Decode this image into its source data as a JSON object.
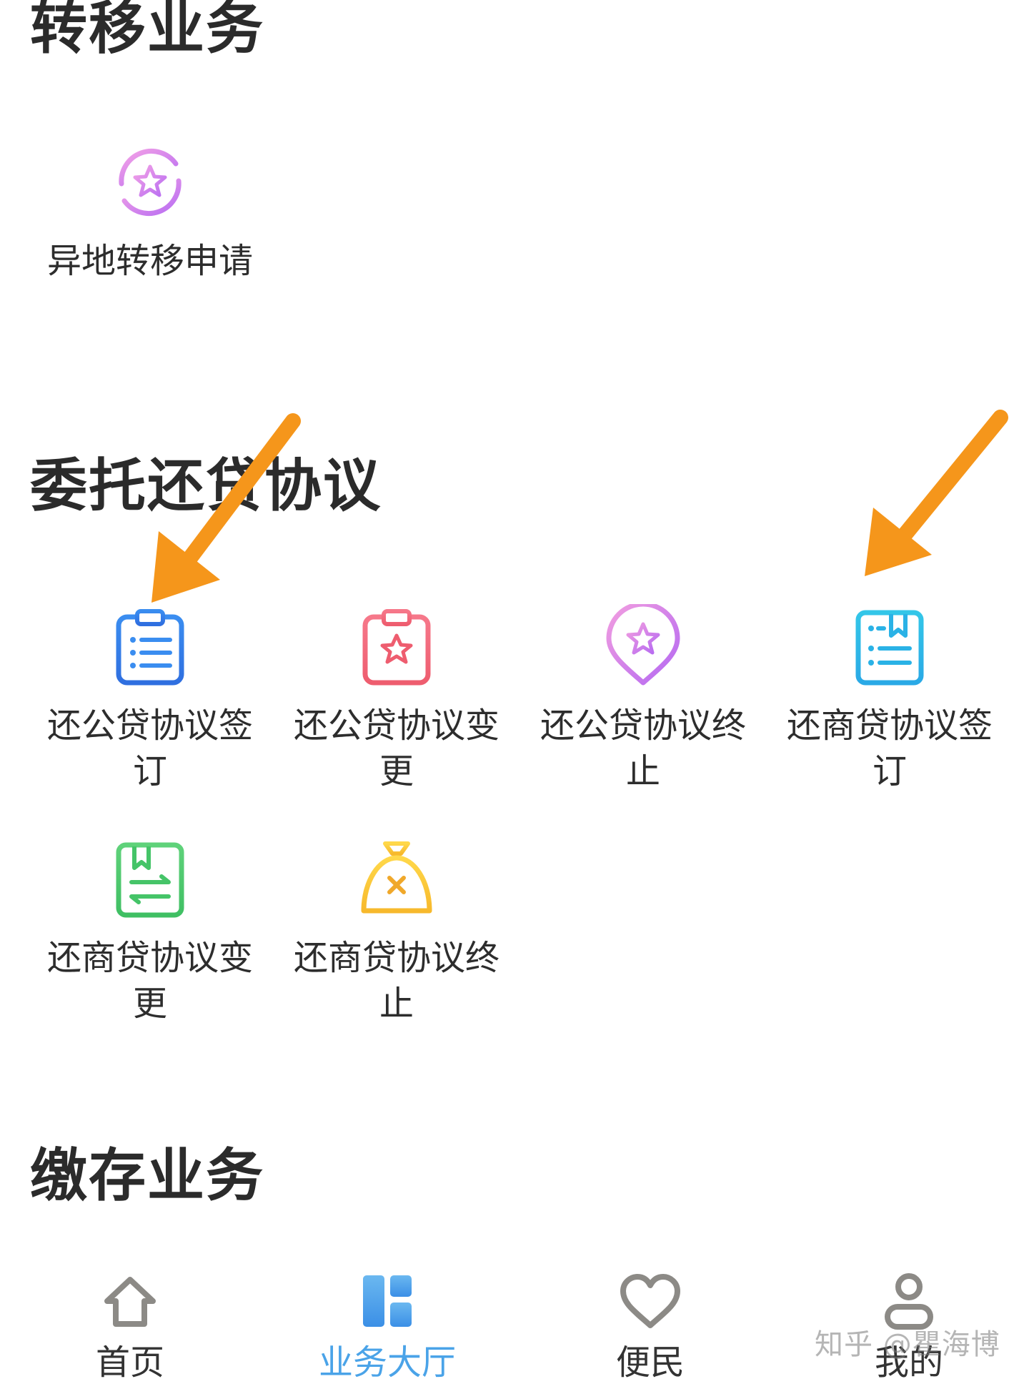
{
  "sections": {
    "transfer": {
      "title": "转移业务",
      "items": [
        {
          "label": "异地转移申请",
          "icon": "star-circle-icon"
        }
      ]
    },
    "loan_agreement": {
      "title": "委托还贷协议",
      "items": [
        {
          "label": "还公贷协议签订",
          "icon": "clipboard-list-icon"
        },
        {
          "label": "还公贷协议变更",
          "icon": "clipboard-star-icon"
        },
        {
          "label": "还公贷协议终止",
          "icon": "location-star-icon"
        },
        {
          "label": "还商贷协议签订",
          "icon": "bookmark-list-icon"
        },
        {
          "label": "还商贷协议变更",
          "icon": "bookmark-exchange-icon"
        },
        {
          "label": "还商贷协议终止",
          "icon": "bell-cancel-icon"
        }
      ]
    },
    "deposit": {
      "title": "缴存业务"
    }
  },
  "tabbar": {
    "tabs": [
      {
        "label": "首页",
        "icon": "home-icon",
        "active": false
      },
      {
        "label": "业务大厅",
        "icon": "grid-icon",
        "active": true
      },
      {
        "label": "便民",
        "icon": "heart-icon",
        "active": false
      },
      {
        "label": "我的",
        "icon": "user-icon",
        "active": false
      }
    ]
  },
  "watermark": "知乎 @瞿海博",
  "colors": {
    "active_tab": "#4aa3e8",
    "arrow": "#f5961b",
    "title_text": "#2b2b2b"
  }
}
